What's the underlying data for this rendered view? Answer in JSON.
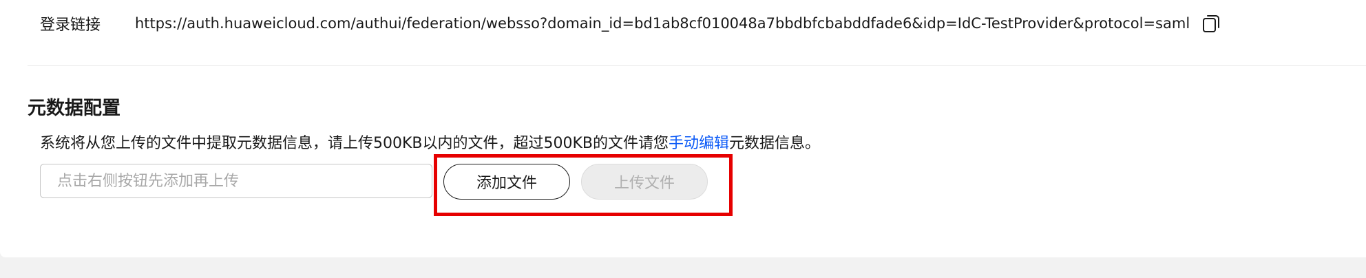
{
  "login": {
    "label": "登录链接",
    "url": "https://auth.huaweicloud.com/authui/federation/websso?domain_id=bd1ab8cf010048a7bbdbfcbabddfade6&idp=IdC-TestProvider&protocol=saml",
    "copy_icon": "copy-icon"
  },
  "metadata": {
    "title": "元数据配置",
    "desc_prefix": "系统将从您上传的文件中提取元数据信息，请上传500KB以内的文件，超过500KB的文件请您",
    "desc_link": "手动编辑",
    "desc_suffix": "元数据信息。",
    "file_placeholder": "点击右侧按钮先添加再上传",
    "file_value": "",
    "add_button": "添加文件",
    "upload_button": "上传文件"
  },
  "colors": {
    "link": "#0a59f7",
    "highlight": "#e60000",
    "disabled_bg": "#ececec",
    "page_bg": "#f2f2f2"
  }
}
